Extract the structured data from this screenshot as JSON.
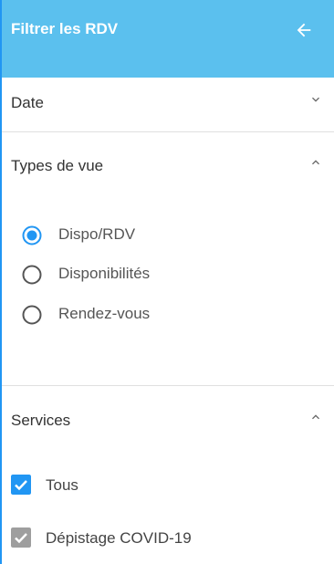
{
  "header": {
    "title": "Filtrer les RDV"
  },
  "sections": {
    "date": {
      "label": "Date",
      "expanded": false
    },
    "view_types": {
      "label": "Types de vue",
      "expanded": true,
      "options": [
        {
          "label": "Dispo/RDV",
          "selected": true
        },
        {
          "label": "Disponibilités",
          "selected": false
        },
        {
          "label": "Rendez-vous",
          "selected": false
        }
      ]
    },
    "services": {
      "label": "Services",
      "expanded": true,
      "items": [
        {
          "label": "Tous",
          "checked": true
        },
        {
          "label": "Dépistage COVID-19",
          "checked": true
        }
      ]
    }
  },
  "colors": {
    "header_bg": "#5bc0ee",
    "accent": "#2196f3",
    "checkbox_disabled": "#9e9e9e"
  },
  "icons": {
    "back": "arrow-left-icon",
    "collapse": "chevron-up-icon",
    "expand": "chevron-down-icon"
  }
}
